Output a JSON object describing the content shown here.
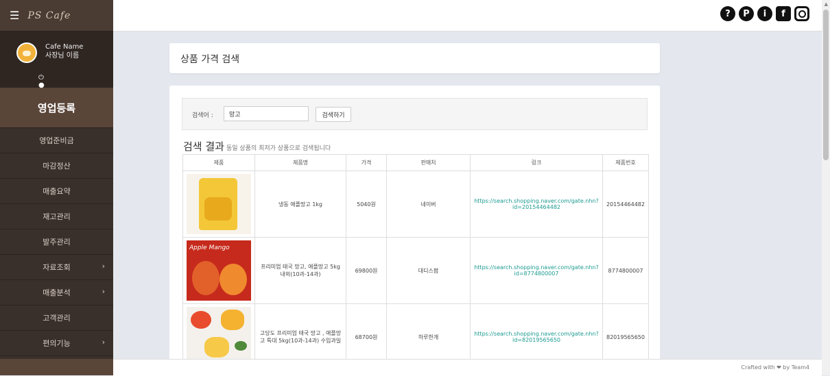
{
  "sidebar": {
    "logo": "PS Cafe",
    "cafe_name": "Cafe Name",
    "owner_name": "사장님 이름",
    "section_title": "영업등록",
    "items": [
      {
        "label": "영업준비금",
        "has_sub": false
      },
      {
        "label": "마감정산",
        "has_sub": false
      },
      {
        "label": "매출요약",
        "has_sub": false
      },
      {
        "label": "재고관리",
        "has_sub": false
      },
      {
        "label": "발주관리",
        "has_sub": false
      },
      {
        "label": "자료조회",
        "has_sub": true
      },
      {
        "label": "매출분석",
        "has_sub": true
      },
      {
        "label": "고객관리",
        "has_sub": false
      },
      {
        "label": "편의기능",
        "has_sub": true
      }
    ]
  },
  "header": {
    "icons": [
      "help-icon",
      "p-icon",
      "info-icon",
      "facebook-icon",
      "instagram-icon"
    ]
  },
  "page": {
    "title": "상품 가격 검색"
  },
  "search": {
    "label": "검색어 :",
    "value": "망고",
    "button": "검색하기"
  },
  "results": {
    "title": "검색 결과",
    "subtitle": "동일 상품의 최저가 상품으로 검색됩니다",
    "columns": [
      "제품",
      "제품명",
      "가격",
      "판매처",
      "링크",
      "제품번호"
    ],
    "rows": [
      {
        "name": "냉동 애플망고 1kg",
        "price": "5040원",
        "seller": "네이버",
        "link": "https://search.shopping.naver.com/gate.nhn?id=20154464482",
        "number": "20154464482"
      },
      {
        "name": "프리미엄 태국 망고, 애플망고 5kg 내외(10과-14과)",
        "price": "69800원",
        "seller": "대디스팜",
        "link": "https://search.shopping.naver.com/gate.nhn?id=8774800007",
        "number": "8774800007"
      },
      {
        "name": "고당도 프리미엄 태국 망고 , 애플망고 특대 5kg(10과-14과) 수입과일",
        "price": "68700원",
        "seller": "하루한개",
        "link": "https://search.shopping.naver.com/gate.nhn?id=82019565650",
        "number": "82019565650"
      }
    ],
    "thumb2_text": "Apple Mango"
  },
  "footer": {
    "text": "Crafted with ❤ by Team4"
  }
}
